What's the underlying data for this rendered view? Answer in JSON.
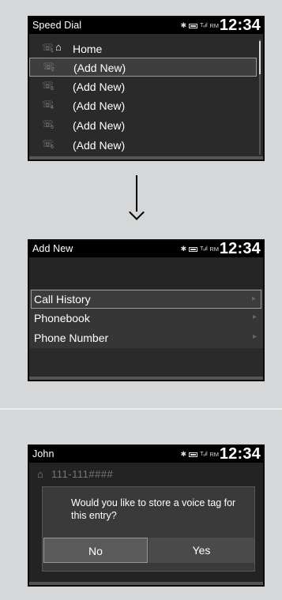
{
  "status_time": "12:34",
  "status_rm": "RM",
  "screen1": {
    "title": "Speed Dial",
    "items": [
      {
        "num": "1",
        "label": "Home"
      },
      {
        "num": "2",
        "label": "(Add New)"
      },
      {
        "num": "3",
        "label": "(Add New)"
      },
      {
        "num": "4",
        "label": "(Add New)"
      },
      {
        "num": "5",
        "label": "(Add New)"
      },
      {
        "num": "6",
        "label": "(Add New)"
      }
    ]
  },
  "screen2": {
    "title": "Add New",
    "items": [
      {
        "label": "Call History"
      },
      {
        "label": "Phonebook"
      },
      {
        "label": "Phone Number"
      }
    ]
  },
  "screen3": {
    "title": "John",
    "number": "111-111####",
    "message": "Would you like to store a voice tag for this entry?",
    "no_label": "No",
    "yes_label": "Yes"
  },
  "icons": {
    "phone": "phone-icon",
    "home": "home-icon",
    "bluetooth": "bluetooth-icon",
    "battery": "battery-icon",
    "signal": "signal-icon",
    "arrow": "down-arrow-icon"
  }
}
